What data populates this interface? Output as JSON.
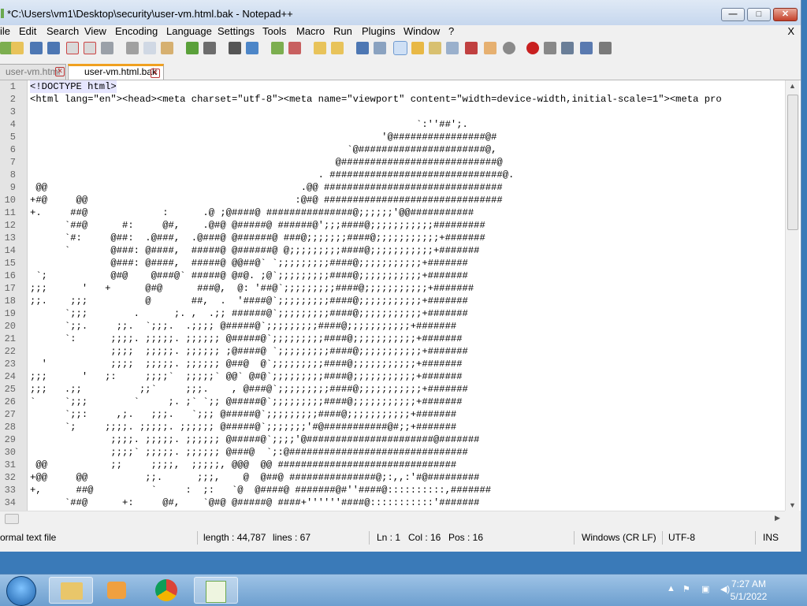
{
  "window": {
    "title": "*C:\\Users\\vm1\\Desktop\\security\\user-vm.html.bak - Notepad++",
    "min_glyph": "—",
    "max_glyph": "□",
    "close_glyph": "✕"
  },
  "menu": {
    "items": [
      "ile",
      "Edit",
      "Search",
      "View",
      "Encoding",
      "Language",
      "Settings",
      "Tools",
      "Macro",
      "Run",
      "Plugins",
      "Window",
      "?"
    ],
    "close_label": "X"
  },
  "tabs": [
    {
      "label": "user-vm.html",
      "active": false,
      "close": "✕"
    },
    {
      "label": "user-vm.html.bak",
      "active": true,
      "close": "✕"
    }
  ],
  "editor": {
    "line_numbers": [
      "1",
      "2",
      "3",
      "4",
      "5",
      "6",
      "7",
      "8",
      "9",
      "10",
      "11",
      "12",
      "13",
      "14",
      "15",
      "16",
      "17",
      "18",
      "19",
      "20",
      "21",
      "22",
      "23",
      "24",
      "25",
      "26",
      "27",
      "28",
      "29",
      "30",
      "31",
      "32",
      "33",
      "34"
    ],
    "lines": [
      "<!DOCTYPE html>",
      "<html lang=\"en\"><head><meta charset=\"utf-8\"><meta name=\"viewport\" content=\"width=device-width,initial-scale=1\"><meta pro",
      "",
      "                                                                   `:''##';.",
      "                                                             '@################@#",
      "                                                       `@######################@,",
      "                                                     @###########################@",
      "                                                  . ##############################@.",
      " @@                                            .@@ ###############################",
      "+#@     @@                                    :@#@ ###############################",
      "+.     ##@             :      .@ ;@####@ ###############@;;;;;;'@@###########",
      "      `##@      #:     @#,    .@#@ @#####@ ######@';;;####@;;;;;;;;;;;#########",
      "      `#:     @##:  .@###,  .@###@ @######@ ###@;;;;;;;####@;;;;;;;;;;;+#######",
      "      `       @###: @####,  #####@ @######@ @;;;;;;;;;####@;;;;;;;;;;;+#######",
      "              @###: @####,  #####@ @@##@` `;;;;;;;;;####@;;;;;;;;;;;+#######",
      " `;           @#@    @###@` #####@ @#@. ;@`;;;;;;;;;####@;;;;;;;;;;;+#######",
      ";;;      '   +      @#@      ###@,  @: '##@`;;;;;;;;;####@;;;;;;;;;;;+#######",
      ";;.    ;;;          @       ##,  .  '####@`;;;;;;;;;####@;;;;;;;;;;;+#######",
      "      `;;;        .      ;. ,  .;; ######@`;;;;;;;;;####@;;;;;;;;;;;+#######",
      "      `;;.     ;;.  `;;;.  .;;;; @#####@`;;;;;;;;;####@;;;;;;;;;;;+#######",
      "      `:      ;;;;. ;;;;;. ;;;;;; @#####@`;;;;;;;;;####@;;;;;;;;;;;+#######",
      "              ;;;;  ;;;;;. ;;;;;; ;@####@ `;;;;;;;;;####@;;;;;;;;;;;+#######",
      "  '           ;;;;  ;;;;;. ;;;;;; @##@  @`;;;;;;;;;####@;;;;;;;;;;;+#######",
      ";;;      '   ;:     ;;;;`  ;;;;;` @@` @#@`;;;;;;;;;####@;;;;;;;;;;;+#######",
      ";;;   .;;          ;;`     ;;;.    , @###@`;;;;;;;;;####@;;;;;;;;;;;+#######",
      "`     `;;;        `     ;. ;` `;; @#####@`;;;;;;;;;####@;;;;;;;;;;;+#######",
      "      `;;:     ,;.   ;;;.   `;;; @#####@`;;;;;;;;;####@;;;;;;;;;;;+#######",
      "      `;     ;;;;. ;;;;;. ;;;;;; @#####@`;;;;;;;'#@###########@#;;+#######",
      "              ;;;;. ;;;;;. ;;;;;; @#####@`;;;;'@######################@#######",
      "              ;;;;` ;;;;;. ;;;;;; @###@  `;:@###############################",
      " @@           ;;     ;;;;,  ;;;;;, @@@  @@ ###############################",
      "+@@     @@          ;;.      ;;;,    @  @##@ ###############@;:,,:'#@#########",
      "+,      ##@          `     :  ;:   `@  @####@ #######@#''####@::::::::::,#######",
      "      `##@      +:     @#,    `@#@ @#####@ ####+''''''####@:::::::::::'#######"
    ]
  },
  "statusbar": {
    "filetype": "ormal text file",
    "length": "length : 44,787",
    "lines": "lines : 67",
    "ln": "Ln : 1",
    "col": "Col : 16",
    "pos": "Pos : 16",
    "eol": "Windows (CR LF)",
    "encoding": "UTF-8",
    "mode": "INS"
  },
  "taskbar": {
    "time": "7:27 AM",
    "date": "5/1/2022"
  }
}
